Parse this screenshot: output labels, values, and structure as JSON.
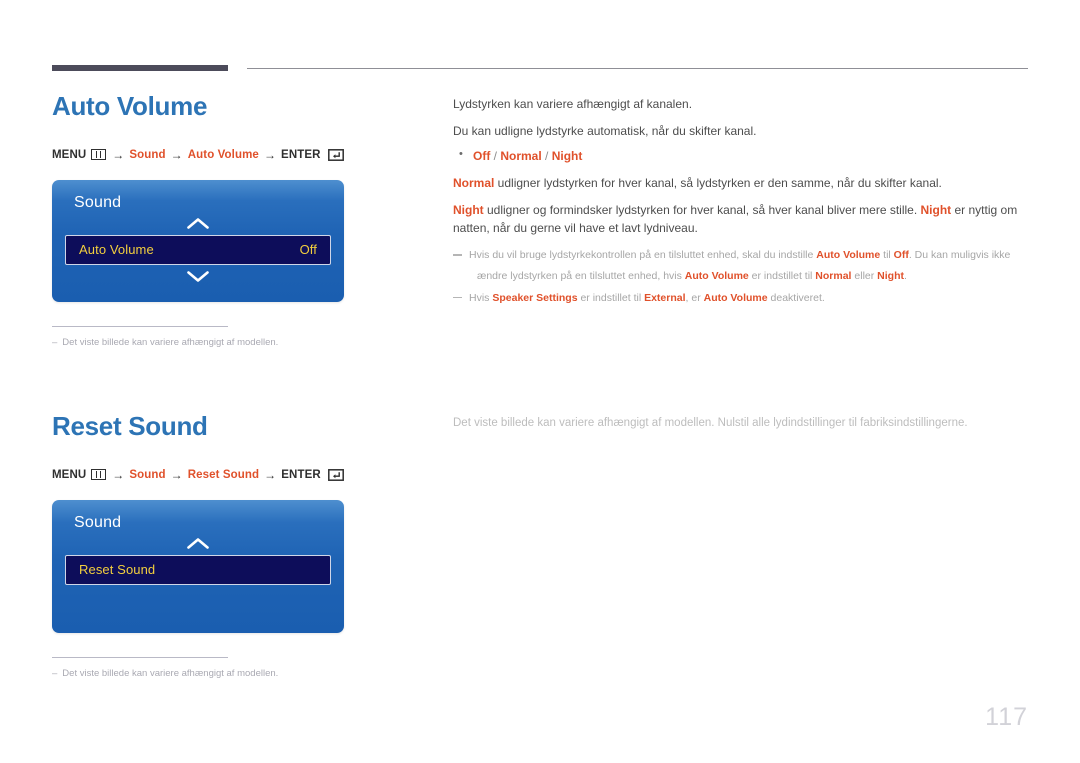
{
  "document": {
    "page_number": "117"
  },
  "sections": [
    {
      "id": "auto-volume",
      "title": "Auto Volume",
      "menu_path": {
        "menu_label": "MENU",
        "menu_icon": "menu-grid-icon",
        "arrow": "→",
        "step1": "Sound",
        "step2": "Auto Volume",
        "enter_label": "ENTER",
        "enter_icon": "enter-return-icon"
      },
      "osd": {
        "title": "Sound",
        "up_chevron_icon": "chevron-up-icon",
        "down_chevron_icon": "chevron-down-icon",
        "has_down_chevron": true,
        "row_label": "Auto Volume",
        "row_value": "Off"
      },
      "caption": {
        "dash": "–",
        "text": "Det viste billede kan variere afhængigt af modellen."
      },
      "body": {
        "para1": "Lydstyrken kan variere afhængigt af kanalen.",
        "para2": "Du kan udligne lydstyrke automatisk, når du skifter kanal.",
        "options": {
          "opt1": "Off",
          "sep1": " / ",
          "opt2": "Normal",
          "sep2": " / ",
          "opt3": "Night"
        },
        "para3_bold": "Normal",
        "para3_rest": " udligner lydstyrken for hver kanal, så lydstyrken er den samme, når du skifter kanal.",
        "para4_bold1": "Night",
        "para4_mid": " udligner og formindsker lydstyrken for hver kanal, så hver kanal bliver mere stille. ",
        "para4_bold2": "Night",
        "para4_end": " er nyttig om natten, når du gerne vil have et lavt lydniveau.",
        "note1_a": "Hvis du vil bruge lydstyrkekontrollen på en tilsluttet enhed, skal du indstille ",
        "note1_b1": "Auto Volume",
        "note1_c": " til ",
        "note1_b2": "Off",
        "note1_d": ". Du kan muligvis ikke",
        "note1_line2_a": "ændre lydstyrken på en tilsluttet enhed, hvis ",
        "note1_line2_b1": "Auto Volume",
        "note1_line2_c": " er indstillet til ",
        "note1_line2_b2": "Normal",
        "note1_line2_d": " eller ",
        "note1_line2_b3": "Night",
        "note1_line2_e": ".",
        "note2_a": "Hvis ",
        "note2_b1": "Speaker Settings",
        "note2_c": " er indstillet til ",
        "note2_b2": "External",
        "note2_d": ", er ",
        "note2_b3": "Auto Volume",
        "note2_e": " deaktiveret."
      }
    },
    {
      "id": "reset-sound",
      "title": "Reset Sound",
      "menu_path": {
        "menu_label": "MENU",
        "menu_icon": "menu-grid-icon",
        "arrow": "→",
        "step1": "Sound",
        "step2": "Reset Sound",
        "enter_label": "ENTER",
        "enter_icon": "enter-return-icon"
      },
      "osd": {
        "title": "Sound",
        "up_chevron_icon": "chevron-up-icon",
        "has_down_chevron": false,
        "row_label": "Reset Sound",
        "row_value": ""
      },
      "caption": {
        "dash": "–",
        "text": "Det viste billede kan variere afhængigt af modellen."
      },
      "body": {
        "para1": "Det viste billede kan variere afhængigt af modellen. Nulstil alle lydindstillinger til fabriksindstillingerne."
      }
    }
  ],
  "colors": {
    "heading_blue": "#2d74b5",
    "accent_orange": "#e0512b",
    "osd_blue": "#1f63b4",
    "osd_row_navy": "#0d0d5a",
    "osd_row_text": "#f2cf3e",
    "rule_dark": "#4c4b5a",
    "muted_gray": "#a6a6a6"
  }
}
